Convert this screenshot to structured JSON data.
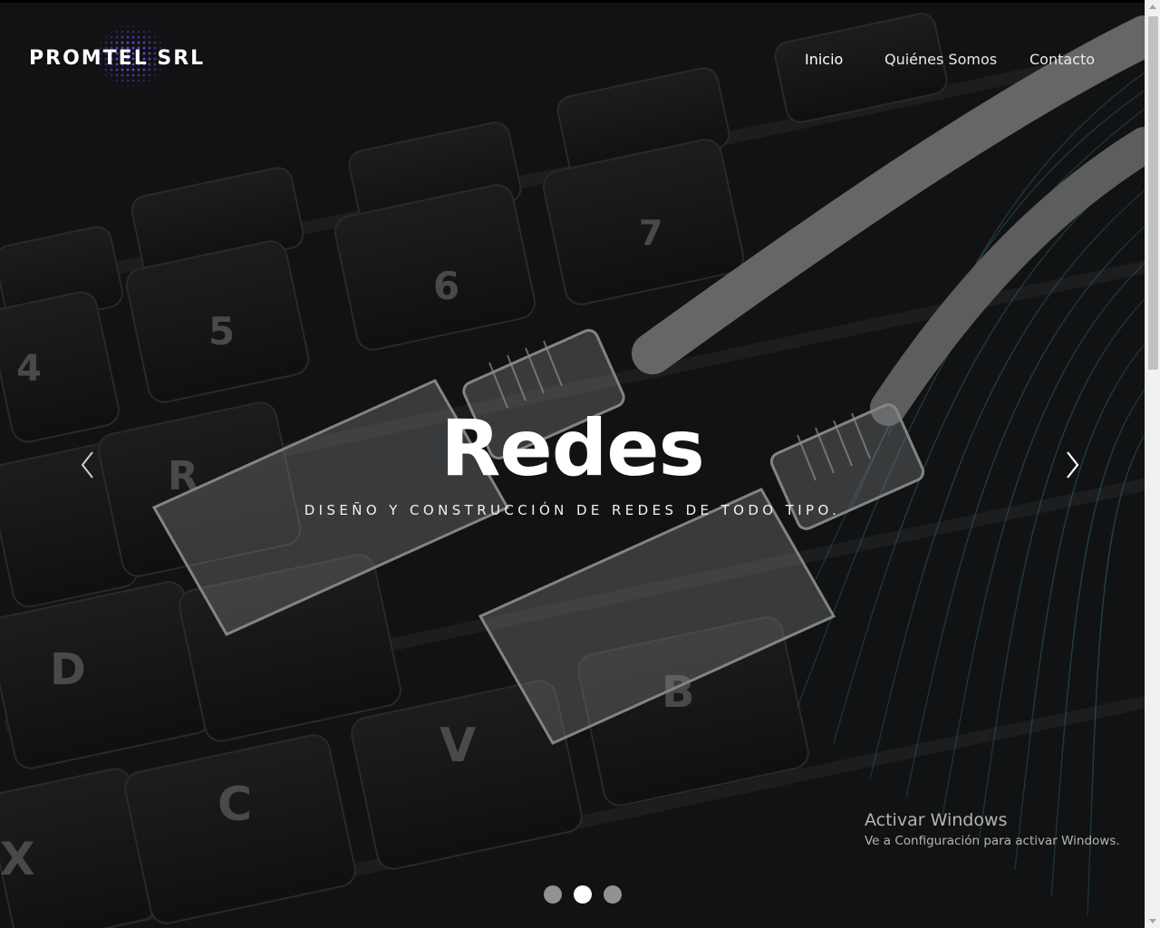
{
  "brand": {
    "name": "PROMTEL SRL"
  },
  "nav": {
    "items": [
      {
        "label": "Inicio",
        "active": true
      },
      {
        "label": "Quiénes Somos",
        "active": false
      },
      {
        "label": "Contacto",
        "active": false
      }
    ]
  },
  "carousel": {
    "title": "Redes",
    "subtitle": "DISEÑO Y CONSTRUCCIÓN DE REDES DE TODO TIPO.",
    "prev_icon": "chevron-left-icon",
    "next_icon": "chevron-right-icon",
    "slide_count": 3,
    "active_slide": 2
  },
  "windows_watermark": {
    "title": "Activar Windows",
    "subtitle": "Ve a Configuración para activar Windows."
  },
  "colors": {
    "accent_teal": "#1e6e73",
    "logo_glow": "#7850ff",
    "text": "#ffffff"
  }
}
